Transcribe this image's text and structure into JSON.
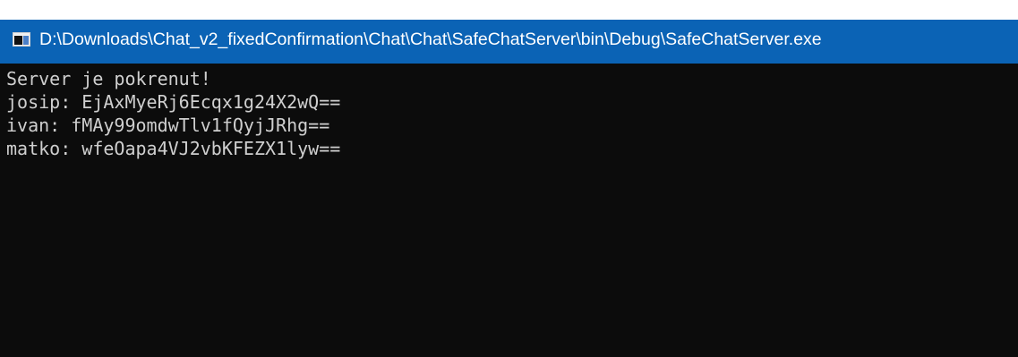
{
  "window": {
    "title": "D:\\Downloads\\Chat_v2_fixedConfirmation\\Chat\\Chat\\SafeChatServer\\bin\\Debug\\SafeChatServer.exe",
    "icon": "console-window-icon"
  },
  "console": {
    "lines": [
      "Server je pokrenut!",
      "josip: EjAxMyeRj6Ecqx1g24X2wQ==",
      "ivan: fMAy99omdwTlv1fQyjJRhg==",
      "matko: wfeOapa4VJ2vbKFEZX1lyw=="
    ]
  },
  "colors": {
    "titlebar": "#0b63b5",
    "console_bg": "#0c0c0c",
    "console_text": "#cfcfcf"
  }
}
